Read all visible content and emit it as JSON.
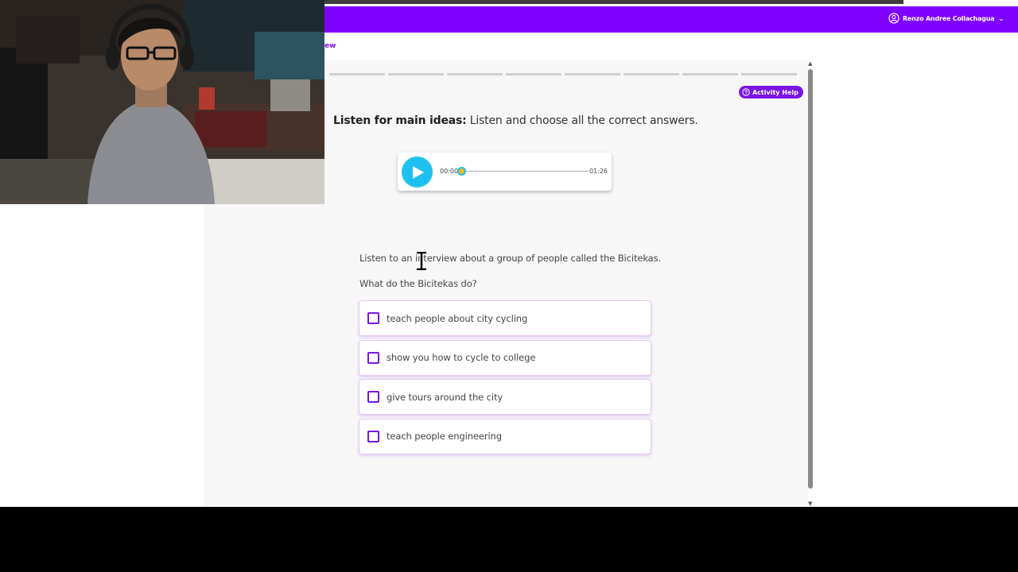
{
  "header": {
    "user_name": "Renzo Andree Collachagua",
    "brand_color": "#8000ff"
  },
  "breadcrumb": {
    "text": "ew"
  },
  "progress": {
    "segments": 8
  },
  "activity": {
    "help_label": "Activity Help",
    "instruction_bold": "Listen for main ideas:",
    "instruction_rest": " Listen and choose all the correct answers."
  },
  "audio": {
    "current_time": "00:00",
    "duration": "01:26",
    "accent_color": "#1ec0f0"
  },
  "task": {
    "intro": "Listen to an interview about a group of people called the Bicitekas.",
    "question": "What do the Bicitekas do?",
    "options": [
      {
        "label": "teach people about city cycling",
        "checked": false
      },
      {
        "label": "show you how to cycle to college",
        "checked": false
      },
      {
        "label": "give tours around the city",
        "checked": false
      },
      {
        "label": "teach people engineering",
        "checked": false
      }
    ]
  },
  "icons": {
    "user": "user-circle-icon",
    "chevron": "chevron-down-icon",
    "help": "question-circle-icon",
    "play": "play-icon",
    "cursor": "text-cursor-icon"
  }
}
